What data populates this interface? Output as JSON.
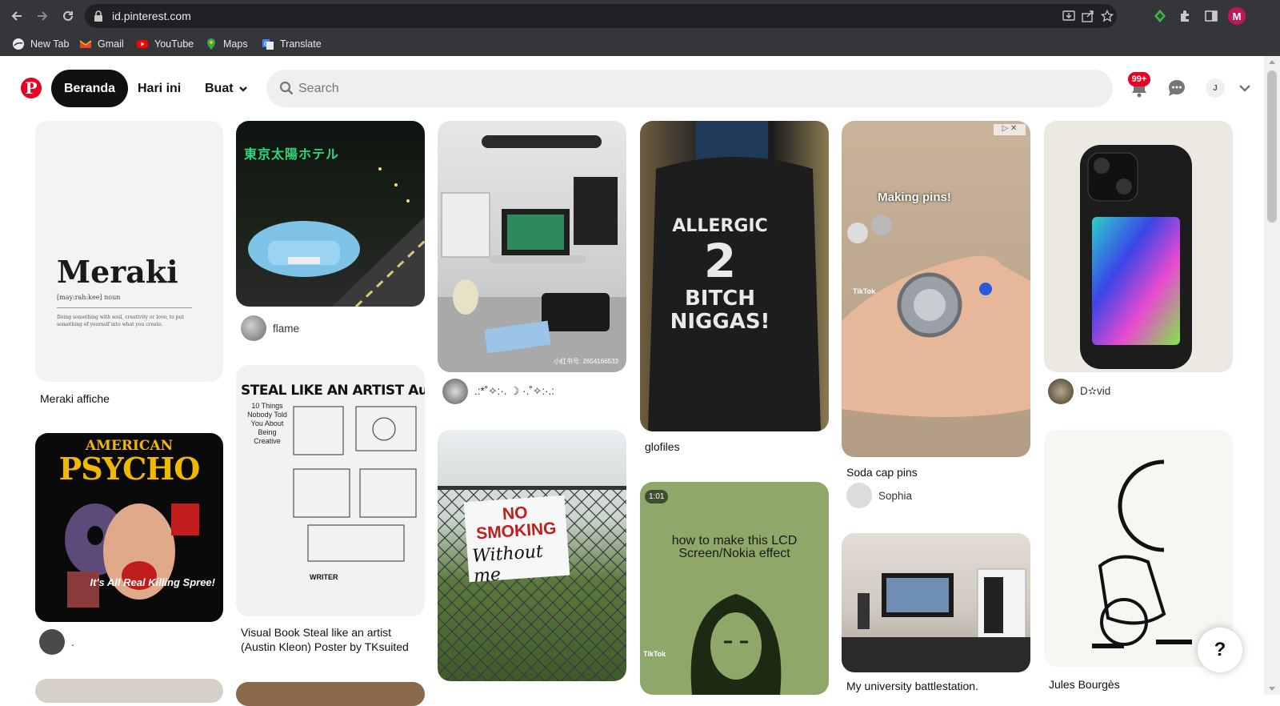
{
  "browser": {
    "url": "id.pinterest.com",
    "profile_initial": "M",
    "bookmarks": [
      {
        "label": "New Tab",
        "icon": "new-tab-icon"
      },
      {
        "label": "Gmail",
        "icon": "gmail-icon"
      },
      {
        "label": "YouTube",
        "icon": "youtube-icon"
      },
      {
        "label": "Maps",
        "icon": "maps-icon"
      },
      {
        "label": "Translate",
        "icon": "translate-icon"
      }
    ]
  },
  "header": {
    "nav": {
      "home": "Beranda",
      "today": "Hari ini",
      "create": "Buat"
    },
    "search_placeholder": "Search",
    "notifications_badge": "99+",
    "avatar_initial": "J",
    "brand_color": "#e60023"
  },
  "pins": {
    "meraki": {
      "title": "Meraki affiche",
      "word": "Meraki",
      "pron": "[may:rah:kee] noun",
      "definition": "Doing something with soul, creativity or love; to put something of yourself into what you create."
    },
    "car": {
      "user": "flame",
      "image_text": "東京太陽ホテル"
    },
    "desk": {
      "user": ".:*˚✧:·. ☽ ·.˚✧:·.:",
      "caption": "小红书号: 2654166533"
    },
    "hoodie": {
      "title": "glofiles",
      "image_text": [
        "ALLERGIC",
        "2",
        "BITCH",
        "NIGGAS!"
      ]
    },
    "cap": {
      "title": "Soda cap pins",
      "user": "Sophia",
      "overlay": "Making pins!",
      "tiktok": "TikTok"
    },
    "phone": {
      "user": "D✫vid"
    },
    "psycho": {
      "user": ".",
      "american": "AMERICAN",
      "psycho": "PSYCHO",
      "spree": "It's All Real Killing Spree!"
    },
    "steal": {
      "title": "Visual Book Steal like an artist (Austin Kleon) Poster by TKsuited",
      "headline": "STEAL LIKE AN ARTIST Austin Kleon",
      "sub": "10 Things Nobody Told You About Being Creative",
      "writer": "WRITER"
    },
    "nosmoke": {
      "sign": "NO SMOKING",
      "hand": "Without me"
    },
    "lcd": {
      "duration": "1:01",
      "headline": "how to make this LCD Screen/Nokia effect",
      "tiktok": "TikTok"
    },
    "battle": {
      "title": "My university battlestation."
    },
    "moon": {
      "user": "Jules Bourgès"
    }
  },
  "help_label": "?"
}
